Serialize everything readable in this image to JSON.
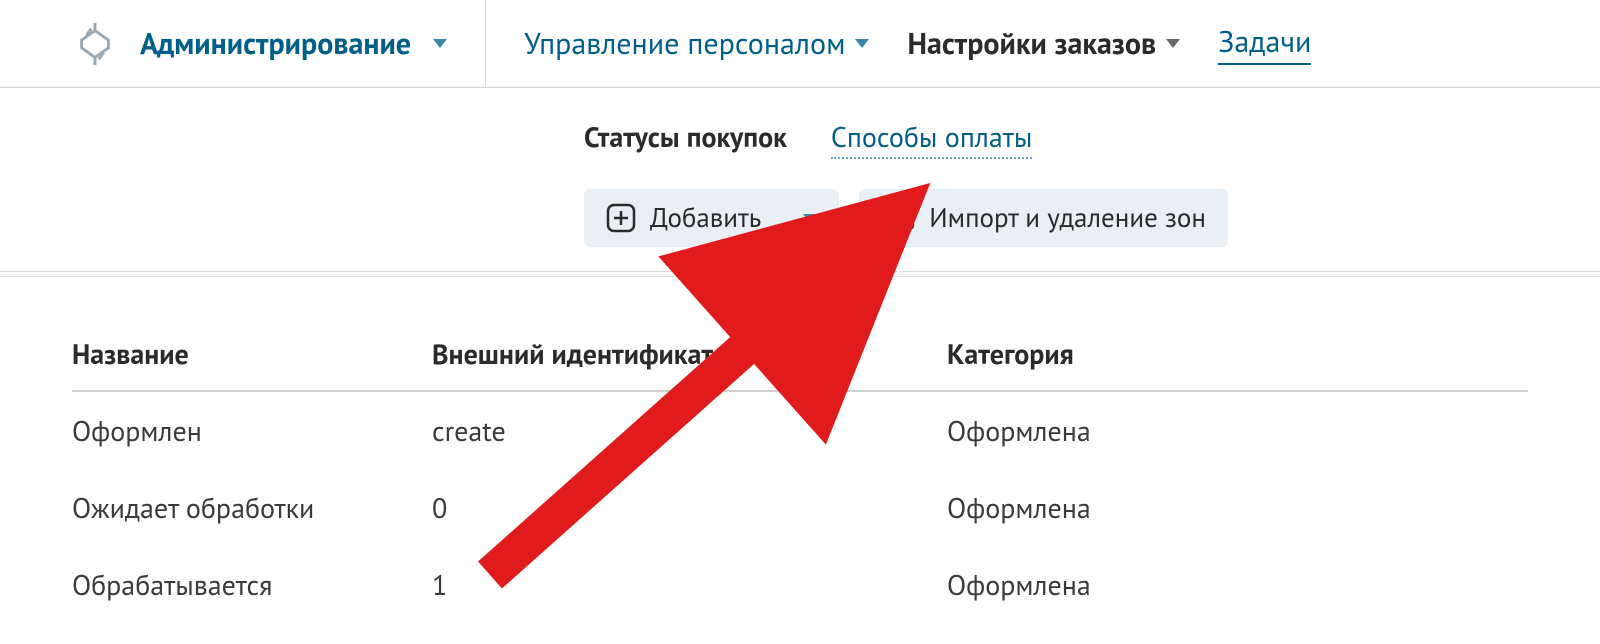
{
  "nav": {
    "admin": "Администрирование",
    "personnel": "Управление персоналом",
    "orders": "Настройки заказов",
    "tasks": "Задачи"
  },
  "subtabs": {
    "statuses": "Статусы покупок",
    "payments": "Способы оплаты"
  },
  "actions": {
    "add": "Добавить",
    "import": "Импорт и удаление зон"
  },
  "table": {
    "headers": {
      "name": "Название",
      "ext_id": "Внешний идентификатор",
      "category": "Категория"
    },
    "rows": [
      {
        "name": "Оформлен",
        "ext_id": "create",
        "category": "Оформлена"
      },
      {
        "name": "Ожидает обработки",
        "ext_id": "0",
        "category": "Оформлена"
      },
      {
        "name": "Обрабатывается",
        "ext_id": "1",
        "category": "Оформлена"
      }
    ]
  },
  "annotation": {
    "arrow_color": "#e11b1b"
  }
}
